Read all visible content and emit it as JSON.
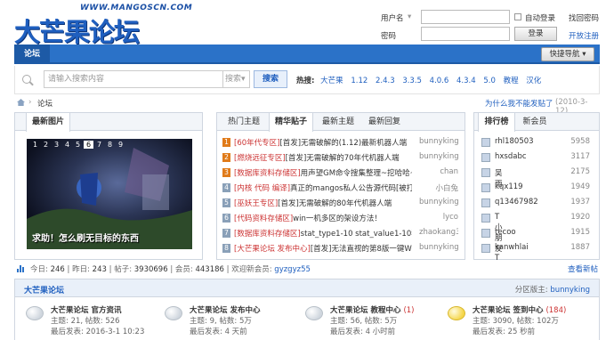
{
  "header": {
    "logo_url": "WWW.MANGOSCN.COM",
    "logo_text": "大芒果论坛",
    "username_label": "用户名",
    "password_label": "密码",
    "autologin_label": "自动登录",
    "forgot_label": "找回密码",
    "login_button": "登录",
    "register_label": "开放注册"
  },
  "nav": {
    "current_tab": "论坛",
    "quick_nav": "快捷导航"
  },
  "search": {
    "placeholder": "请输入搜索内容",
    "type": "搜索",
    "button": "搜索",
    "hot_label": "热搜:",
    "hot_items": [
      "大芒果",
      "1.12",
      "2.4.3",
      "3.3.5",
      "4.0.6",
      "4.3.4",
      "5.0",
      "教程",
      "汉化"
    ]
  },
  "breadcrumb": {
    "current": "论坛",
    "why_not_post": "为什么我不能发贴了",
    "date": "(2010-3-12)"
  },
  "latest_image": {
    "title": "最新图片",
    "slides": [
      "1",
      "2",
      "3",
      "4",
      "5",
      "6",
      "7",
      "8",
      "9"
    ],
    "active_slide": "6",
    "caption": "求助！怎么刷无目标的东西"
  },
  "threads": {
    "tabs": [
      "热门主题",
      "精华贴子",
      "最新主题",
      "最新回复"
    ],
    "active_tab": "精华贴子",
    "items": [
      {
        "n": "1",
        "cat": "[60年代专区]",
        "title": "[首发]无需破解的(1.12)最新机器人端",
        "author": "bunnyking"
      },
      {
        "n": "2",
        "cat": "[燃烧远征专区]",
        "title": "[首发]无需破解的70年代机器人端",
        "author": "bunnyking"
      },
      {
        "n": "3",
        "cat": "[数据库资料存储区]",
        "title": "用声望GM命令搜集整理~挖哈哈~想借很多",
        "author": "chan"
      },
      {
        "n": "4",
        "cat": "[内核 代码 编译]",
        "title": "真正的mangos私人公告源代码[被打如精]",
        "author": "小白兔"
      },
      {
        "n": "5",
        "cat": "[巫妖王专区]",
        "title": "[首发]无需破解的80年代机器人端",
        "author": "bunnyking"
      },
      {
        "n": "6",
        "cat": "[代码资料存储区]",
        "title": "win一机多区的架设方法！",
        "author": "lyco"
      },
      {
        "n": "7",
        "cat": "[数据库资料存储区]",
        "title": "stat_type1-10 stat_value1-10我自己",
        "author": "zhaokang36"
      },
      {
        "n": "8",
        "cat": "[大芒果论坛 发布中心]",
        "title": "[首发]无法直视的第8版一键WEB环",
        "author": "bunnyking"
      }
    ]
  },
  "ranking": {
    "tabs": [
      "排行榜",
      "新会员"
    ],
    "items": [
      {
        "name": "rhl180503",
        "score": "5958"
      },
      {
        "name": "hxsdabc",
        "score": "3117"
      },
      {
        "name": "吴雨",
        "score": "2175"
      },
      {
        "name": "kqx119",
        "score": "1949"
      },
      {
        "name": "q13467982",
        "score": "1937"
      },
      {
        "name": "T小朋友T",
        "score": "1920"
      },
      {
        "name": "tecoo",
        "score": "1915"
      },
      {
        "name": "kanwhlai",
        "score": "1887"
      }
    ]
  },
  "stats": {
    "today_label": "今日:",
    "today": "246",
    "yesterday_label": "昨日:",
    "yesterday": "243",
    "posts_label": "帖子:",
    "posts": "3930696",
    "members_label": "会员:",
    "members": "443186",
    "newest_label": "欢迎新会员:",
    "newest": "gyzgyz55",
    "new_posts_link": "查看新帖"
  },
  "forum": {
    "title": "大芒果论坛",
    "moderator_label": "分区版主:",
    "moderator": "bunnyking",
    "boards": [
      {
        "name": "大芒果论坛 官方资讯",
        "count": "",
        "stats": "主题: 21, 帖数: 526",
        "last": "最后发表: 2016-3-1 10:23",
        "new": false
      },
      {
        "name": "大芒果论坛 发布中心",
        "count": "",
        "stats": "主题: 9, 帖数: 5万",
        "last": "最后发表: 4 天前",
        "new": false
      },
      {
        "name": "大芒果论坛 教程中心",
        "count": "(1)",
        "stats": "主题: 56, 帖数: 5万",
        "last": "最后发表: 4 小时前",
        "new": false
      },
      {
        "name": "大芒果论坛 签到中心",
        "count": "(184)",
        "stats": "主题: 3090, 帖数: 102万",
        "last": "最后发表: 25 秒前",
        "new": true
      }
    ]
  }
}
